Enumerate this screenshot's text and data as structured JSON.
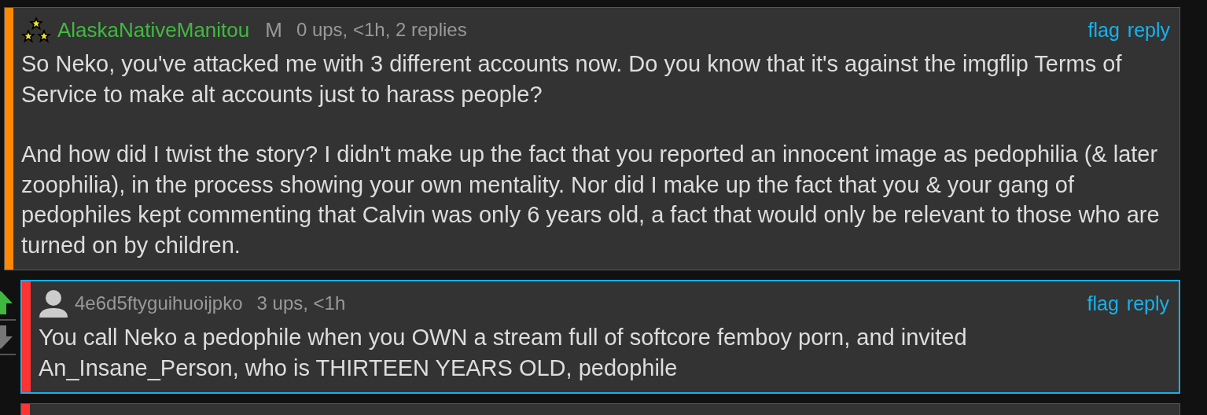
{
  "comments": [
    {
      "user": "AlaskaNativeManitou",
      "kind": "member",
      "badge": "M",
      "meta": "0 ups, <1h, 2 replies",
      "color": "#ff8800",
      "highlighted": false,
      "indent": false,
      "paragraphs": [
        "So Neko, you've attacked me with 3 different accounts now. Do you know that it's against the imgflip Terms of Service to make alt accounts just to harass people?",
        "And how did I twist the story? I didn't make up the fact that you reported an innocent image as pedophilia (& later zoophilia), in the process showing your own mentality. Nor did I make up the fact that you & your gang of pedophiles kept commenting that Calvin was only 6 years old, a fact that would only be relevant to those who are turned on by children."
      ],
      "actions": [
        "flag",
        "reply"
      ]
    },
    {
      "user": "4e6d5ftyguihuoijpko",
      "kind": "anon",
      "meta": "3 ups, <1h",
      "color": "#ff3333",
      "highlighted": true,
      "indent": true,
      "upvoted": true,
      "paragraphs": [
        "You call Neko a pedophile when you OWN a stream full of softcore femboy porn, and invited An_Insane_Person, who is THIRTEEN YEARS OLD, pedophile"
      ],
      "actions": [
        "flag",
        "reply"
      ]
    }
  ],
  "next_comment": {
    "color": "#ff3333"
  }
}
